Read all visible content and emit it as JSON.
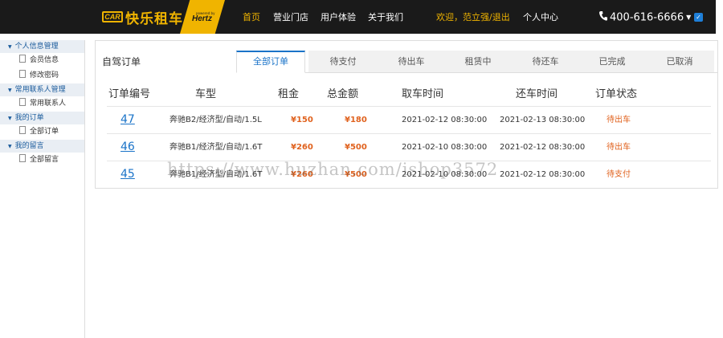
{
  "header": {
    "logo_box": "CAR",
    "logo_text": "快乐租车",
    "partner_powered": "powered by",
    "partner_name": "Hertz",
    "nav": [
      "首页",
      "营业门店",
      "用户体验",
      "关于我们"
    ],
    "welcome_prefix": "欢迎，",
    "user_name": "范立强",
    "welcome_sep": "/",
    "logout": "退出",
    "user_center": "个人中心",
    "phone": "400-616-6666",
    "accent_color": "#f0b400"
  },
  "sidebar": {
    "groups": [
      {
        "label": "个人信息管理",
        "items": [
          "会员信息",
          "修改密码"
        ]
      },
      {
        "label": "常用联系人管理",
        "items": [
          "常用联系人"
        ]
      },
      {
        "label": "我的订单",
        "items": [
          "全部订单"
        ]
      },
      {
        "label": "我的留言",
        "items": [
          "全部留言"
        ]
      }
    ]
  },
  "main": {
    "title": "自驾订单",
    "tabs": [
      "全部订单",
      "待支付",
      "待出车",
      "租赁中",
      "待还车",
      "已完成",
      "已取消"
    ],
    "active_tab": "全部订单",
    "columns": [
      "订单编号",
      "车型",
      "租金",
      "总金额",
      "取车时间",
      "还车时间",
      "订单状态"
    ],
    "orders": [
      {
        "id": "47",
        "car": "奔驰B2/经济型/自动/1.5L",
        "rent": "¥150",
        "total": "¥180",
        "pickup": "2021-02-12 08:30:00",
        "return": "2021-02-13 08:30:00",
        "status": "待出车"
      },
      {
        "id": "46",
        "car": "奔驰B1/经济型/自动/1.6T",
        "rent": "¥260",
        "total": "¥500",
        "pickup": "2021-02-10 08:30:00",
        "return": "2021-02-12 08:30:00",
        "status": "待出车"
      },
      {
        "id": "45",
        "car": "奔驰B1/经济型/自动/1.6T",
        "rent": "¥260",
        "total": "¥500",
        "pickup": "2021-02-10 08:30:00",
        "return": "2021-02-12 08:30:00",
        "status": "待支付"
      }
    ]
  },
  "watermark": "https://www.huzhan.com/ishop3572"
}
